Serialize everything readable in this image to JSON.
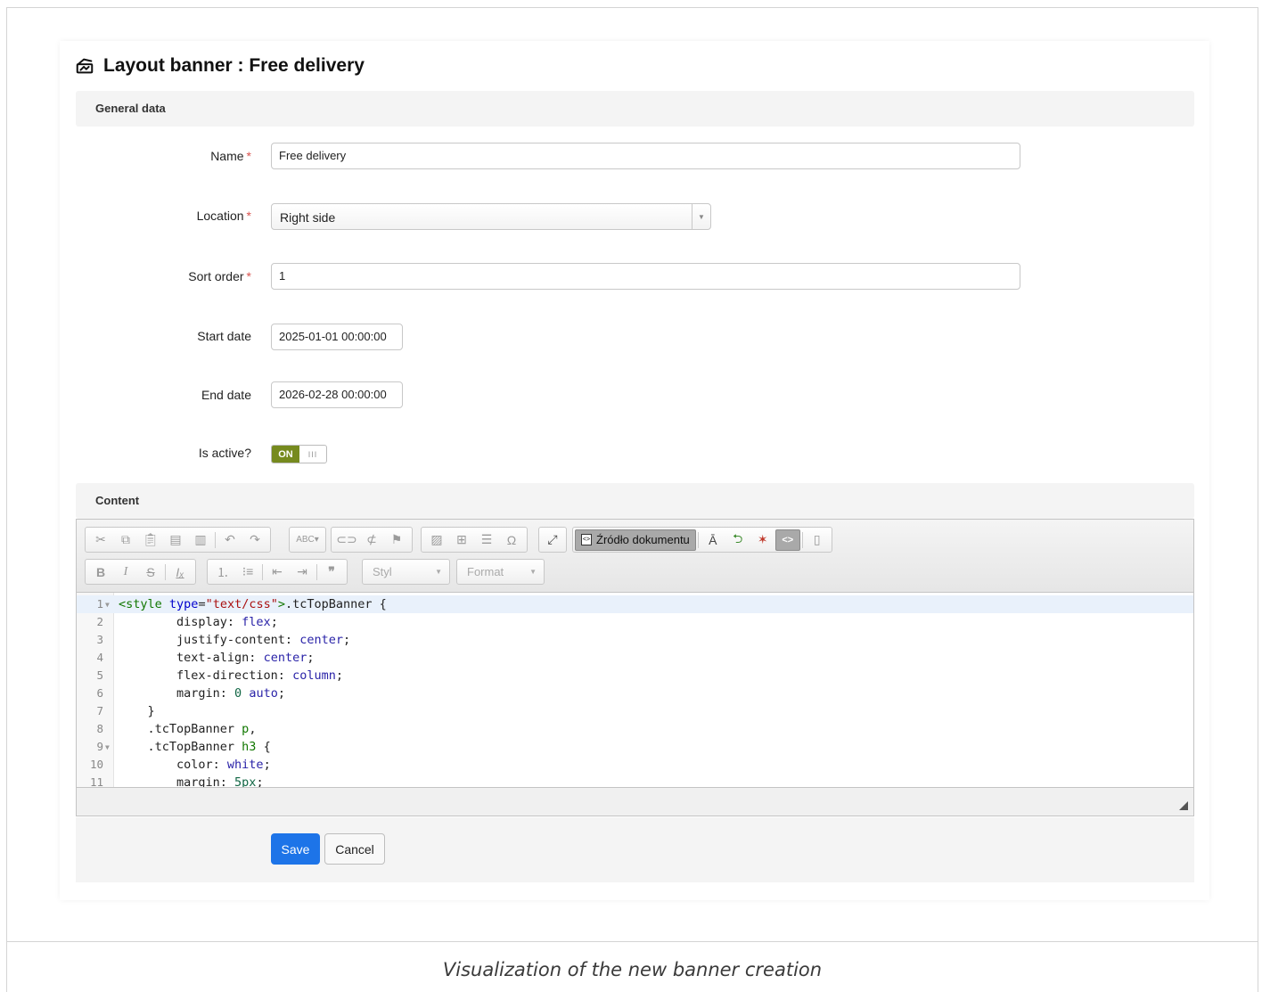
{
  "page": {
    "title": "Layout banner : Free delivery",
    "title_icon": "banner-icon"
  },
  "sections": {
    "general": "General data",
    "content": "Content"
  },
  "form": {
    "name": {
      "label": "Name",
      "required_mark": "*",
      "value": "Free delivery"
    },
    "location": {
      "label": "Location",
      "required_mark": "*",
      "value": "Right side"
    },
    "sort_order": {
      "label": "Sort order",
      "required_mark": "*",
      "value": "1"
    },
    "start_date": {
      "label": "Start date",
      "value": "2025-01-01 00:00:00"
    },
    "end_date": {
      "label": "End date",
      "value": "2026-02-28 00:00:00"
    },
    "is_active": {
      "label": "Is active?",
      "on_label": "ON",
      "off_glyph": "III",
      "state": true
    }
  },
  "editor": {
    "source_button": "Źródło dokumentu",
    "style_combo": "Styl",
    "format_combo": "Format",
    "code_lines": [
      {
        "n": "1",
        "fold": true
      },
      {
        "n": "2",
        "fold": false
      },
      {
        "n": "3",
        "fold": false
      },
      {
        "n": "4",
        "fold": false
      },
      {
        "n": "5",
        "fold": false
      },
      {
        "n": "6",
        "fold": false
      },
      {
        "n": "7",
        "fold": false
      },
      {
        "n": "8",
        "fold": false
      },
      {
        "n": "9",
        "fold": true
      },
      {
        "n": "10",
        "fold": false
      },
      {
        "n": "11",
        "fold": false
      }
    ],
    "code_text": {
      "l1_tag_open": "<style",
      "l1_attr": "type",
      "l1_eq": "=",
      "l1_str": "\"text/css\"",
      "l1_tag_close": ">",
      "l1_rest": ".tcTopBanner {",
      "l2_prop": "        display: ",
      "l2_val": "flex",
      "l3_prop": "        justify-content: ",
      "l3_val": "center",
      "l4_prop": "        text-align: ",
      "l4_val": "center",
      "l5_prop": "        flex-direction: ",
      "l5_val": "column",
      "l6_prop": "        margin: ",
      "l6_num": "0",
      "l6_val": "auto",
      "l7": "    }",
      "l8_sel": "    .tcTopBanner ",
      "l8_tag": "p",
      "l8_end": ",",
      "l9_sel": "    .tcTopBanner ",
      "l9_tag": "h3",
      "l9_end": " {",
      "l10_prop": "        color: ",
      "l10_val": "white",
      "l11_prop": "        margin: ",
      "l11_num": "5px",
      "semicolon": ";"
    }
  },
  "actions": {
    "save": "Save",
    "cancel": "Cancel"
  },
  "caption": "Visualization of the new banner creation",
  "colors": {
    "primary": "#1d74e8",
    "toggle_on": "#768a1e",
    "required": "#d9534f"
  }
}
